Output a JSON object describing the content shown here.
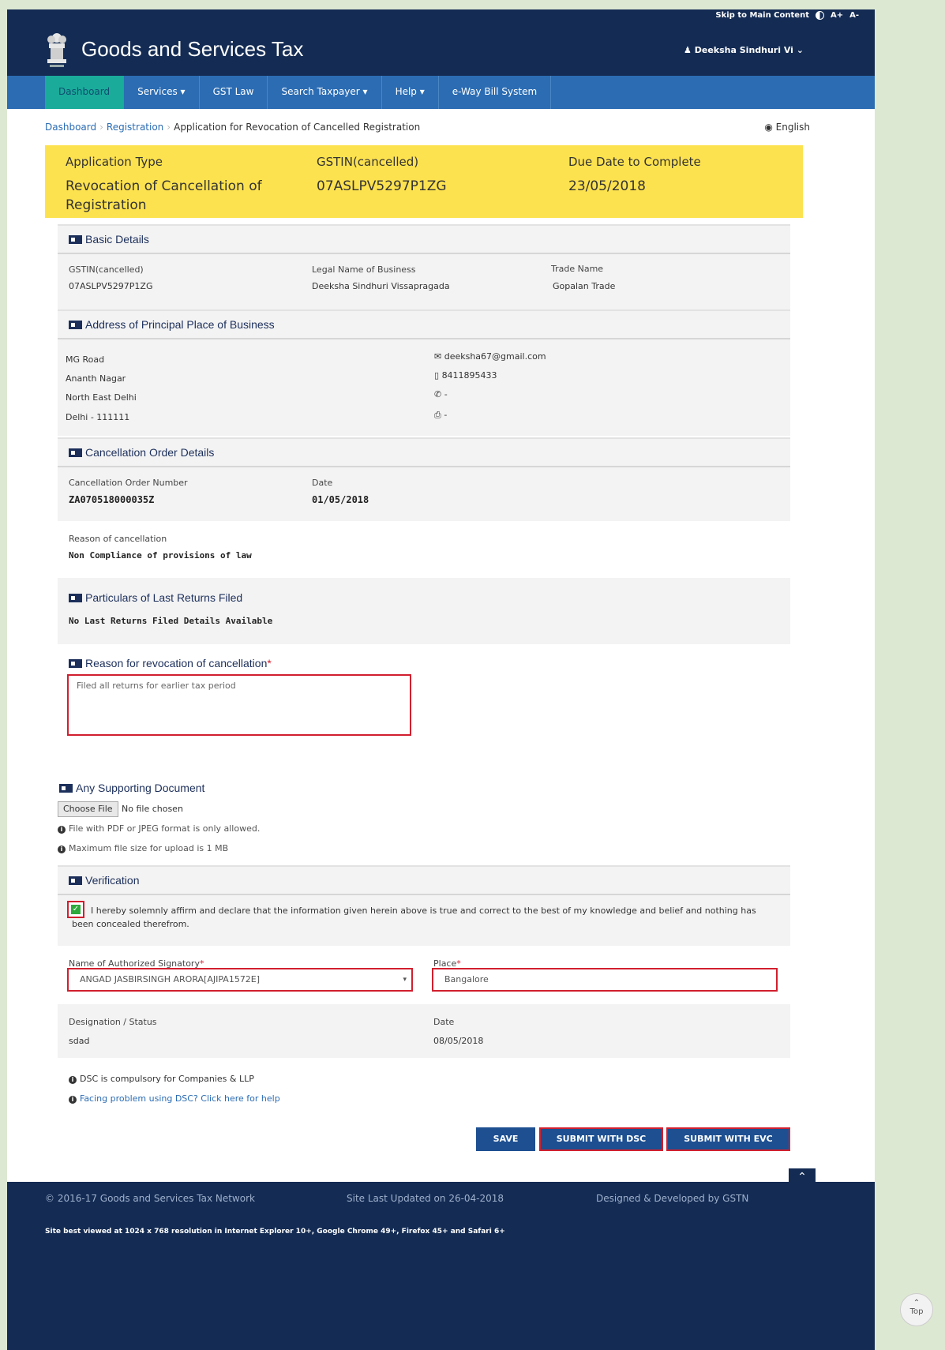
{
  "header": {
    "skip_link": "Skip to Main Content",
    "font_larger": "A+",
    "font_smaller": "A-",
    "brand": "Goods and Services Tax",
    "user": "Deeksha Sindhuri Vi"
  },
  "nav": {
    "items": [
      "Dashboard",
      "Services ▾",
      "GST Law",
      "Search Taxpayer ▾",
      "Help ▾",
      "e-Way Bill System"
    ]
  },
  "breadcrumb": {
    "dashboard": "Dashboard",
    "registration": "Registration",
    "current": "Application for Revocation of Cancelled Registration"
  },
  "language": "English",
  "summary": {
    "app_type_label": "Application Type",
    "app_type_value": "Revocation of Cancellation of Registration",
    "gstin_label": "GSTIN(cancelled)",
    "gstin_value": "07ASLPV5297P1ZG",
    "due_label": "Due Date to Complete",
    "due_value": "23/05/2018"
  },
  "basic": {
    "title": "Basic Details",
    "gstin_label": "GSTIN(cancelled)",
    "gstin_value": "07ASLPV5297P1ZG",
    "legal_label": "Legal Name of Business",
    "legal_value": "Deeksha Sindhuri Vissapragada",
    "trade_label": "Trade Name",
    "trade_value": "Gopalan Trade"
  },
  "address": {
    "title": "Address of Principal Place of Business",
    "line1": "MG Road",
    "line2": "Ananth Nagar",
    "line3": "North East Delhi",
    "line4": "Delhi - 111111",
    "email": "deeksha67@gmail.com",
    "mobile": "8411895433",
    "phone": "-",
    "fax": "-"
  },
  "cancellation": {
    "title": "Cancellation Order Details",
    "order_label": "Cancellation Order Number",
    "order_value": "ZA070518000035Z",
    "date_label": "Date",
    "date_value": "01/05/2018",
    "reason_label": "Reason of cancellation",
    "reason_value": "Non Compliance of provisions of law"
  },
  "returns": {
    "title": "Particulars of Last Returns Filed",
    "value": "No Last Returns Filed Details Available"
  },
  "revocation": {
    "title": "Reason for revocation of cancellation",
    "required": "*",
    "text": "Filed all returns for earlier tax period"
  },
  "supporting": {
    "title": "Any Supporting Document",
    "choose_file": "Choose File",
    "no_file": "No file chosen",
    "note1": "File with PDF or JPEG format is only allowed.",
    "note2": "Maximum file size for upload is 1 MB"
  },
  "verification": {
    "title": "Verification",
    "declaration": "I hereby solemnly affirm and declare that the information given herein above is true and correct to the best of my knowledge and belief and nothing has been concealed therefrom.",
    "checked": true,
    "signatory_label": "Name of Authorized Signatory",
    "signatory_value": "ANGAD JASBIRSINGH ARORA[AJIPA1572E]",
    "place_label": "Place",
    "place_value": "Bangalore",
    "designation_label": "Designation / Status",
    "designation_value": "sdad",
    "date_label": "Date",
    "date_value": "08/05/2018",
    "dsc_note": "DSC is compulsory for Companies & LLP",
    "dsc_help": "Facing problem using DSC? Click here for help"
  },
  "actions": {
    "save": "SAVE",
    "submit_dsc": "SUBMIT WITH DSC",
    "submit_evc": "SUBMIT WITH EVC"
  },
  "footer": {
    "copyright": "© 2016-17 Goods and Services Tax Network",
    "updated": "Site Last Updated on 26-04-2018",
    "designed": "Designed & Developed by GSTN",
    "best_viewed": "Site best viewed at 1024 x 768 resolution in Internet Explorer 10+, Google Chrome 49+, Firefox 45+ and Safari 6+",
    "top_label": "Top"
  },
  "colors": {
    "header_bg": "#142c54",
    "nav_bg": "#2b6cb3",
    "active_tab": "#1aab9b",
    "summary_bg": "#fde24f",
    "highlight": "#d11f2e"
  }
}
